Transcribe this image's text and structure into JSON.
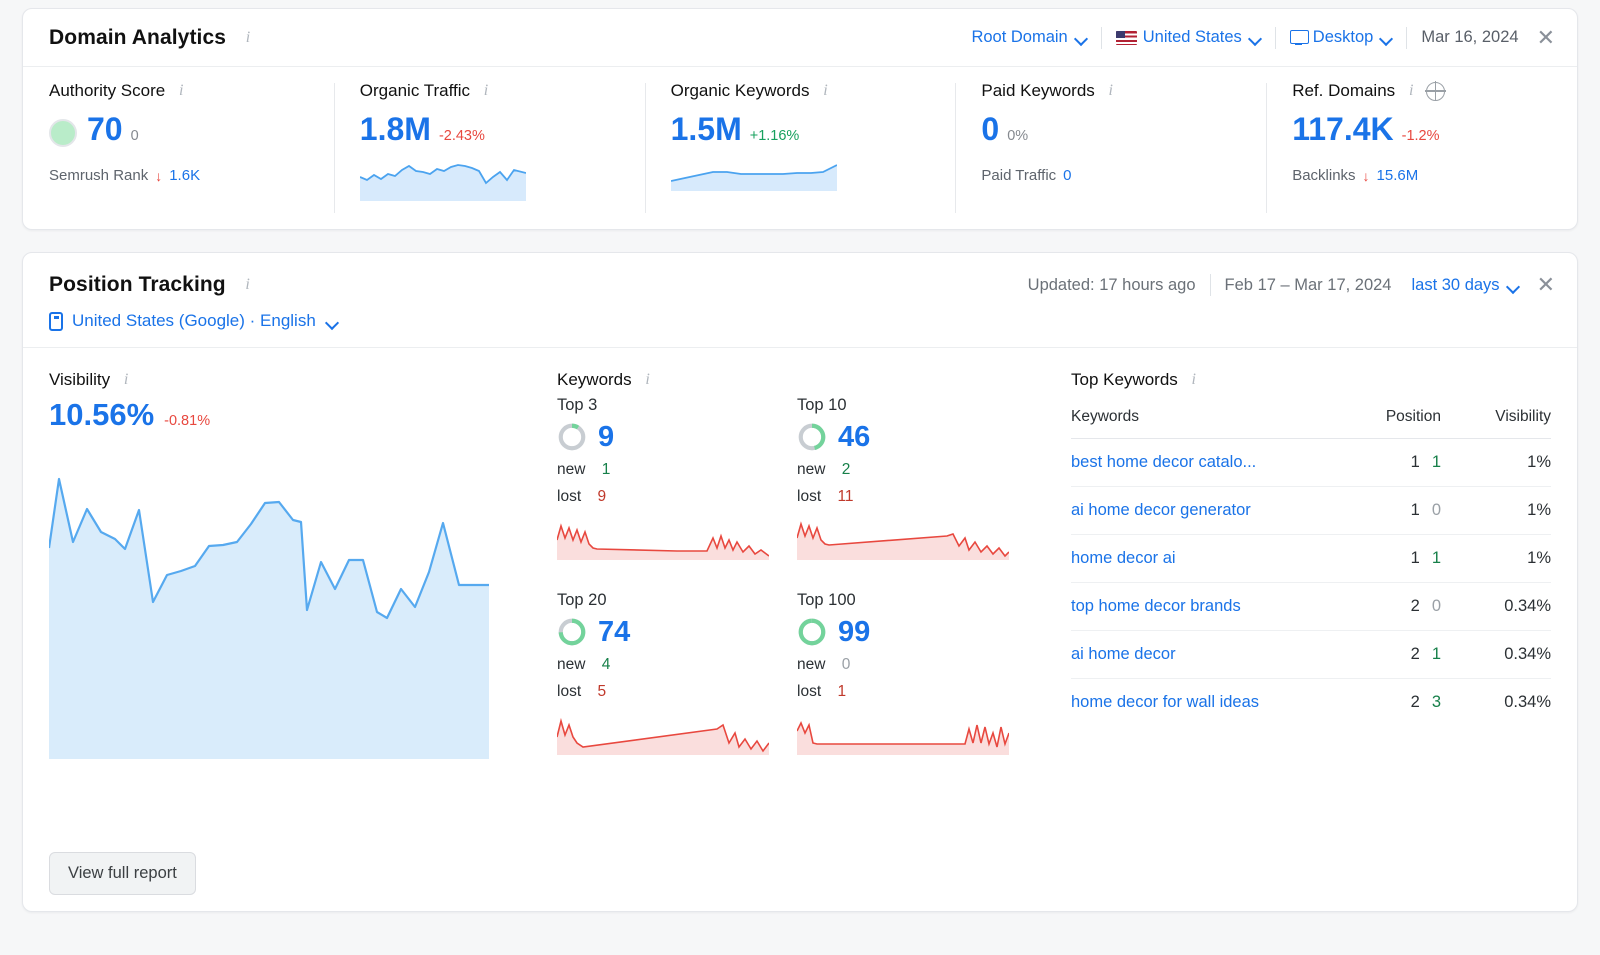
{
  "domain_analytics": {
    "title": "Domain Analytics",
    "controls": {
      "scope": "Root Domain",
      "country": "United States",
      "device": "Desktop",
      "date": "Mar 16, 2024"
    },
    "metrics": [
      {
        "label": "Authority Score",
        "value": "70",
        "delta": "0",
        "delta_kind": "neutral",
        "sub_label": "Semrush Rank",
        "sub_value": "1.6K",
        "sub_arrow": "↓"
      },
      {
        "label": "Organic Traffic",
        "value": "1.8M",
        "delta": "-2.43%",
        "delta_kind": "neg"
      },
      {
        "label": "Organic Keywords",
        "value": "1.5M",
        "delta": "+1.16%",
        "delta_kind": "pos"
      },
      {
        "label": "Paid Keywords",
        "value": "0",
        "delta": "0%",
        "delta_kind": "neutral",
        "sub_label": "Paid Traffic",
        "sub_value": "0"
      },
      {
        "label": "Ref. Domains",
        "value": "117.4K",
        "delta": "-1.2%",
        "delta_kind": "neg",
        "sub_label": "Backlinks",
        "sub_value": "15.6M",
        "sub_arrow": "↓"
      }
    ]
  },
  "position_tracking": {
    "title": "Position Tracking",
    "updated": "Updated: 17 hours ago",
    "date_range": "Feb 17 – Mar 17, 2024",
    "period": "last 30 days",
    "location": "United States (Google) · English",
    "visibility": {
      "label": "Visibility",
      "value": "10.56%",
      "delta": "-0.81%",
      "delta_kind": "neg"
    },
    "keywords": {
      "label": "Keywords",
      "buckets": [
        {
          "label": "Top 3",
          "value": "9",
          "pct": 9,
          "new_label": "new",
          "new": "1",
          "new_kind": "g",
          "lost_label": "lost",
          "lost": "9",
          "lost_kind": "r"
        },
        {
          "label": "Top 10",
          "value": "46",
          "pct": 46,
          "new_label": "new",
          "new": "2",
          "new_kind": "g",
          "lost_label": "lost",
          "lost": "11",
          "lost_kind": "r"
        },
        {
          "label": "Top 20",
          "value": "74",
          "pct": 74,
          "new_label": "new",
          "new": "4",
          "new_kind": "g",
          "lost_label": "lost",
          "lost": "5",
          "lost_kind": "r"
        },
        {
          "label": "Top 100",
          "value": "99",
          "pct": 99,
          "new_label": "new",
          "new": "0",
          "new_kind": "z",
          "lost_label": "lost",
          "lost": "1",
          "lost_kind": "r"
        }
      ]
    },
    "top_keywords": {
      "label": "Top Keywords",
      "columns": [
        "Keywords",
        "Position",
        "Visibility"
      ],
      "rows": [
        {
          "keyword": "best home decor catalo...",
          "position": "1",
          "change": "1",
          "change_kind": "g",
          "visibility": "1%"
        },
        {
          "keyword": "ai home decor generator",
          "position": "1",
          "change": "0",
          "change_kind": "z",
          "visibility": "1%"
        },
        {
          "keyword": "home decor ai",
          "position": "1",
          "change": "1",
          "change_kind": "g",
          "visibility": "1%"
        },
        {
          "keyword": "top home decor brands",
          "position": "2",
          "change": "0",
          "change_kind": "z",
          "visibility": "0.34%"
        },
        {
          "keyword": "ai home decor",
          "position": "2",
          "change": "1",
          "change_kind": "g",
          "visibility": "0.34%"
        },
        {
          "keyword": "home decor for wall ideas",
          "position": "2",
          "change": "3",
          "change_kind": "g",
          "visibility": "0.34%"
        }
      ]
    },
    "view_full_report": "View full report"
  },
  "chart_data": [
    {
      "type": "area",
      "title": "Visibility",
      "ylabel": "Visibility %",
      "xlabel": "",
      "grid": false,
      "series": [
        {
          "name": "Visibility",
          "values": [
            11.2,
            13.4,
            11.5,
            12.6,
            11.9,
            11.7,
            11.6,
            12.5,
            10.6,
            10.2,
            10.45,
            10.5,
            10.9,
            11.1,
            11.15,
            11.6,
            12.1,
            12.8,
            12.6,
            12.5,
            10.3,
            11.0,
            10.5,
            11.2,
            11.2,
            10.1,
            9.95,
            10.6,
            10.1,
            11.0,
            12.3,
            10.9
          ]
        }
      ],
      "color": "#4ba3ef",
      "fill": "#d7eafc"
    },
    {
      "type": "area",
      "title": "Organic Traffic sparkline",
      "series": [
        {
          "name": "Organic Traffic",
          "values": [
            1.78,
            1.76,
            1.79,
            1.77,
            1.8,
            1.79,
            1.82,
            1.86,
            1.82,
            1.81,
            1.8,
            1.83,
            1.82,
            1.86,
            1.88,
            1.87,
            1.86,
            1.84,
            1.74,
            1.78,
            1.82,
            1.76,
            1.83,
            1.8
          ]
        }
      ],
      "color": "#4ba3ef",
      "fill": "#d7eafc"
    },
    {
      "type": "area",
      "title": "Organic Keywords sparkline",
      "series": [
        {
          "name": "Organic Keywords",
          "values": [
            1.44,
            1.46,
            1.48,
            1.5,
            1.5,
            1.49,
            1.49,
            1.49,
            1.49,
            1.5,
            1.5,
            1.51,
            1.55
          ]
        }
      ],
      "color": "#4ba3ef",
      "fill": "#d7eafc"
    },
    {
      "type": "area",
      "title": "Top 3 keywords trend",
      "series": [
        {
          "name": "Top 3",
          "values": [
            19,
            14,
            17,
            13,
            16,
            12,
            9,
            9,
            9,
            9,
            9,
            9,
            9,
            9,
            9,
            9,
            9,
            9,
            9,
            9,
            9,
            8.6,
            8.4,
            8.2,
            8,
            13,
            9,
            12,
            8,
            11,
            7,
            9,
            6,
            8,
            5
          ]
        }
      ],
      "color": "#e8483f",
      "fill": "#fadedd"
    },
    {
      "type": "area",
      "title": "Top 10 keywords trend",
      "series": [
        {
          "name": "Top 10",
          "values": [
            19,
            14,
            17,
            13,
            16,
            11,
            11,
            11.4,
            11.8,
            12.2,
            12.6,
            13,
            13.4,
            13.8,
            14.2,
            14.6,
            15,
            15.4,
            15.8,
            16.2,
            16.6,
            17,
            17.4,
            17.8,
            18,
            18.2,
            13,
            15,
            10,
            12,
            7,
            9,
            5,
            7,
            4
          ]
        }
      ],
      "color": "#e8483f",
      "fill": "#fadedd"
    },
    {
      "type": "area",
      "title": "Top 20 keywords trend",
      "series": [
        {
          "name": "Top 20",
          "values": [
            18,
            13,
            16,
            12,
            15,
            8,
            7.5,
            8,
            8.4,
            8.8,
            9.2,
            9.6,
            10,
            10.4,
            10.8,
            11.2,
            11.6,
            12,
            12.4,
            12.8,
            13.2,
            13.6,
            14,
            14.4,
            14.8,
            15.2,
            16,
            11,
            14,
            9,
            12,
            8,
            11,
            7,
            10
          ]
        }
      ],
      "color": "#e8483f",
      "fill": "#fadedd"
    },
    {
      "type": "area",
      "title": "Top 100 keywords trend",
      "series": [
        {
          "name": "Top 100",
          "values": [
            16,
            11,
            15,
            10,
            9.5,
            9.5,
            9.5,
            9.5,
            9.5,
            9.5,
            9.5,
            9.5,
            9.5,
            9.5,
            9.5,
            9.5,
            9.5,
            9.5,
            9.5,
            9.5,
            9.5,
            9.5,
            9.5,
            9.5,
            9.5,
            9.5,
            16,
            10,
            15,
            9,
            16,
            10,
            15,
            9,
            14
          ]
        }
      ],
      "color": "#e8483f",
      "fill": "#fadedd"
    }
  ]
}
